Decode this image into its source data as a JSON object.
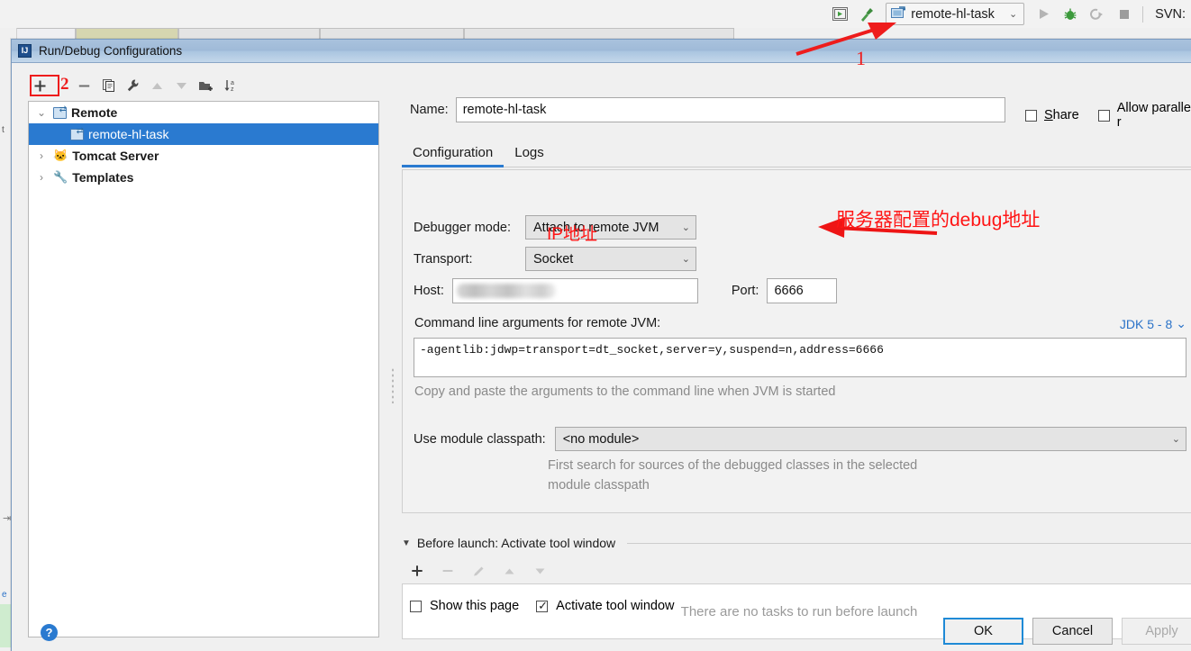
{
  "ide_toolbar": {
    "icons": [
      "run-configurations-icon",
      "build-icon"
    ],
    "run_config_selector": {
      "label": "remote-hl-task",
      "icon": "remote-debug-icon",
      "chevron": "⌄"
    },
    "actions": [
      "run-icon",
      "debug-icon",
      "run-with-coverage-icon",
      "stop-icon"
    ],
    "svn_label": "SVN:"
  },
  "dialog": {
    "title": "Run/Debug Configurations",
    "title_icon": "intellij-idea-icon"
  },
  "tree_toolbar": {
    "buttons": [
      {
        "name": "add-configuration-button",
        "glyph": "+",
        "enabled": true
      },
      {
        "name": "remove-configuration-button",
        "glyph": "−",
        "enabled": true
      },
      {
        "name": "copy-configuration-button",
        "glyph": "⧉",
        "enabled": true
      },
      {
        "name": "edit-templates-button",
        "glyph": "🔧",
        "enabled": true
      },
      {
        "name": "move-up-button",
        "glyph": "▲",
        "enabled": false
      },
      {
        "name": "move-down-button",
        "glyph": "▼",
        "enabled": false
      },
      {
        "name": "new-folder-button",
        "glyph": "📁",
        "enabled": true
      },
      {
        "name": "sort-configurations-button",
        "glyph": "↓az",
        "enabled": true
      }
    ]
  },
  "tree": {
    "items": [
      {
        "label": "Remote",
        "twisty": "⌄",
        "icon": "remote-debug-icon",
        "selected": false,
        "child": false
      },
      {
        "label": "remote-hl-task",
        "twisty": "",
        "icon": "remote-debug-icon",
        "selected": true,
        "child": true
      },
      {
        "label": "Tomcat Server",
        "twisty": "›",
        "icon": "tomcat-icon",
        "selected": false,
        "child": false
      },
      {
        "label": "Templates",
        "twisty": "›",
        "icon": "wrench-icon",
        "selected": false,
        "child": false
      }
    ]
  },
  "form": {
    "name_label": "Name:",
    "name_value": "remote-hl-task",
    "share_label": "Share",
    "share_checked": false,
    "allow_parallel_label": "Allow parallel r",
    "allow_parallel_checked": false,
    "tabs": [
      {
        "label": "Configuration",
        "active": true
      },
      {
        "label": "Logs",
        "active": false
      }
    ],
    "debugger_mode_label": "Debugger mode:",
    "debugger_mode_value": "Attach to remote JVM",
    "transport_label": "Transport:",
    "transport_value": "Socket",
    "host_label": "Host:",
    "host_value": "",
    "port_label": "Port:",
    "port_value": "6666",
    "command_line_label": "Command line arguments for remote JVM:",
    "jdk_selector": "JDK 5 - 8",
    "jdk_chevron": "⌄",
    "command_line_value": "-agentlib:jdwp=transport=dt_socket,server=y,suspend=n,address=6666",
    "command_line_hint": "Copy and paste the arguments to the command line when JVM is started",
    "module_classpath_label": "Use module classpath:",
    "module_classpath_value": "<no module>",
    "module_classpath_hint_line1": "First search for sources of the debugged classes in the selected",
    "module_classpath_hint_line2": "module classpath"
  },
  "before_launch": {
    "header": "Before launch: Activate tool window",
    "triangle": "▼",
    "toolbar": [
      {
        "name": "add-task-button",
        "glyph": "+",
        "enabled": true
      },
      {
        "name": "remove-task-button",
        "glyph": "−",
        "enabled": false
      },
      {
        "name": "edit-task-button",
        "glyph": "✎",
        "enabled": false
      },
      {
        "name": "move-task-up-button",
        "glyph": "▲",
        "enabled": false
      },
      {
        "name": "move-task-down-button",
        "glyph": "▼",
        "enabled": false
      }
    ],
    "empty_text": "There are no tasks to run before launch"
  },
  "bottom": {
    "show_page_label": "Show this page",
    "show_page_checked": false,
    "activate_tool_window_label": "Activate tool window",
    "activate_tool_window_checked": true,
    "help_glyph": "?",
    "buttons": [
      {
        "label": "OK",
        "style": "default"
      },
      {
        "label": "Cancel",
        "style": "normal"
      },
      {
        "label": "Apply",
        "style": "disabled"
      }
    ]
  },
  "annotations": {
    "marker_1": "1",
    "marker_2": "2",
    "ip_note": "IP地址",
    "debug_note": "服务器配置的debug地址",
    "accent_color": "#ee1c1c"
  }
}
